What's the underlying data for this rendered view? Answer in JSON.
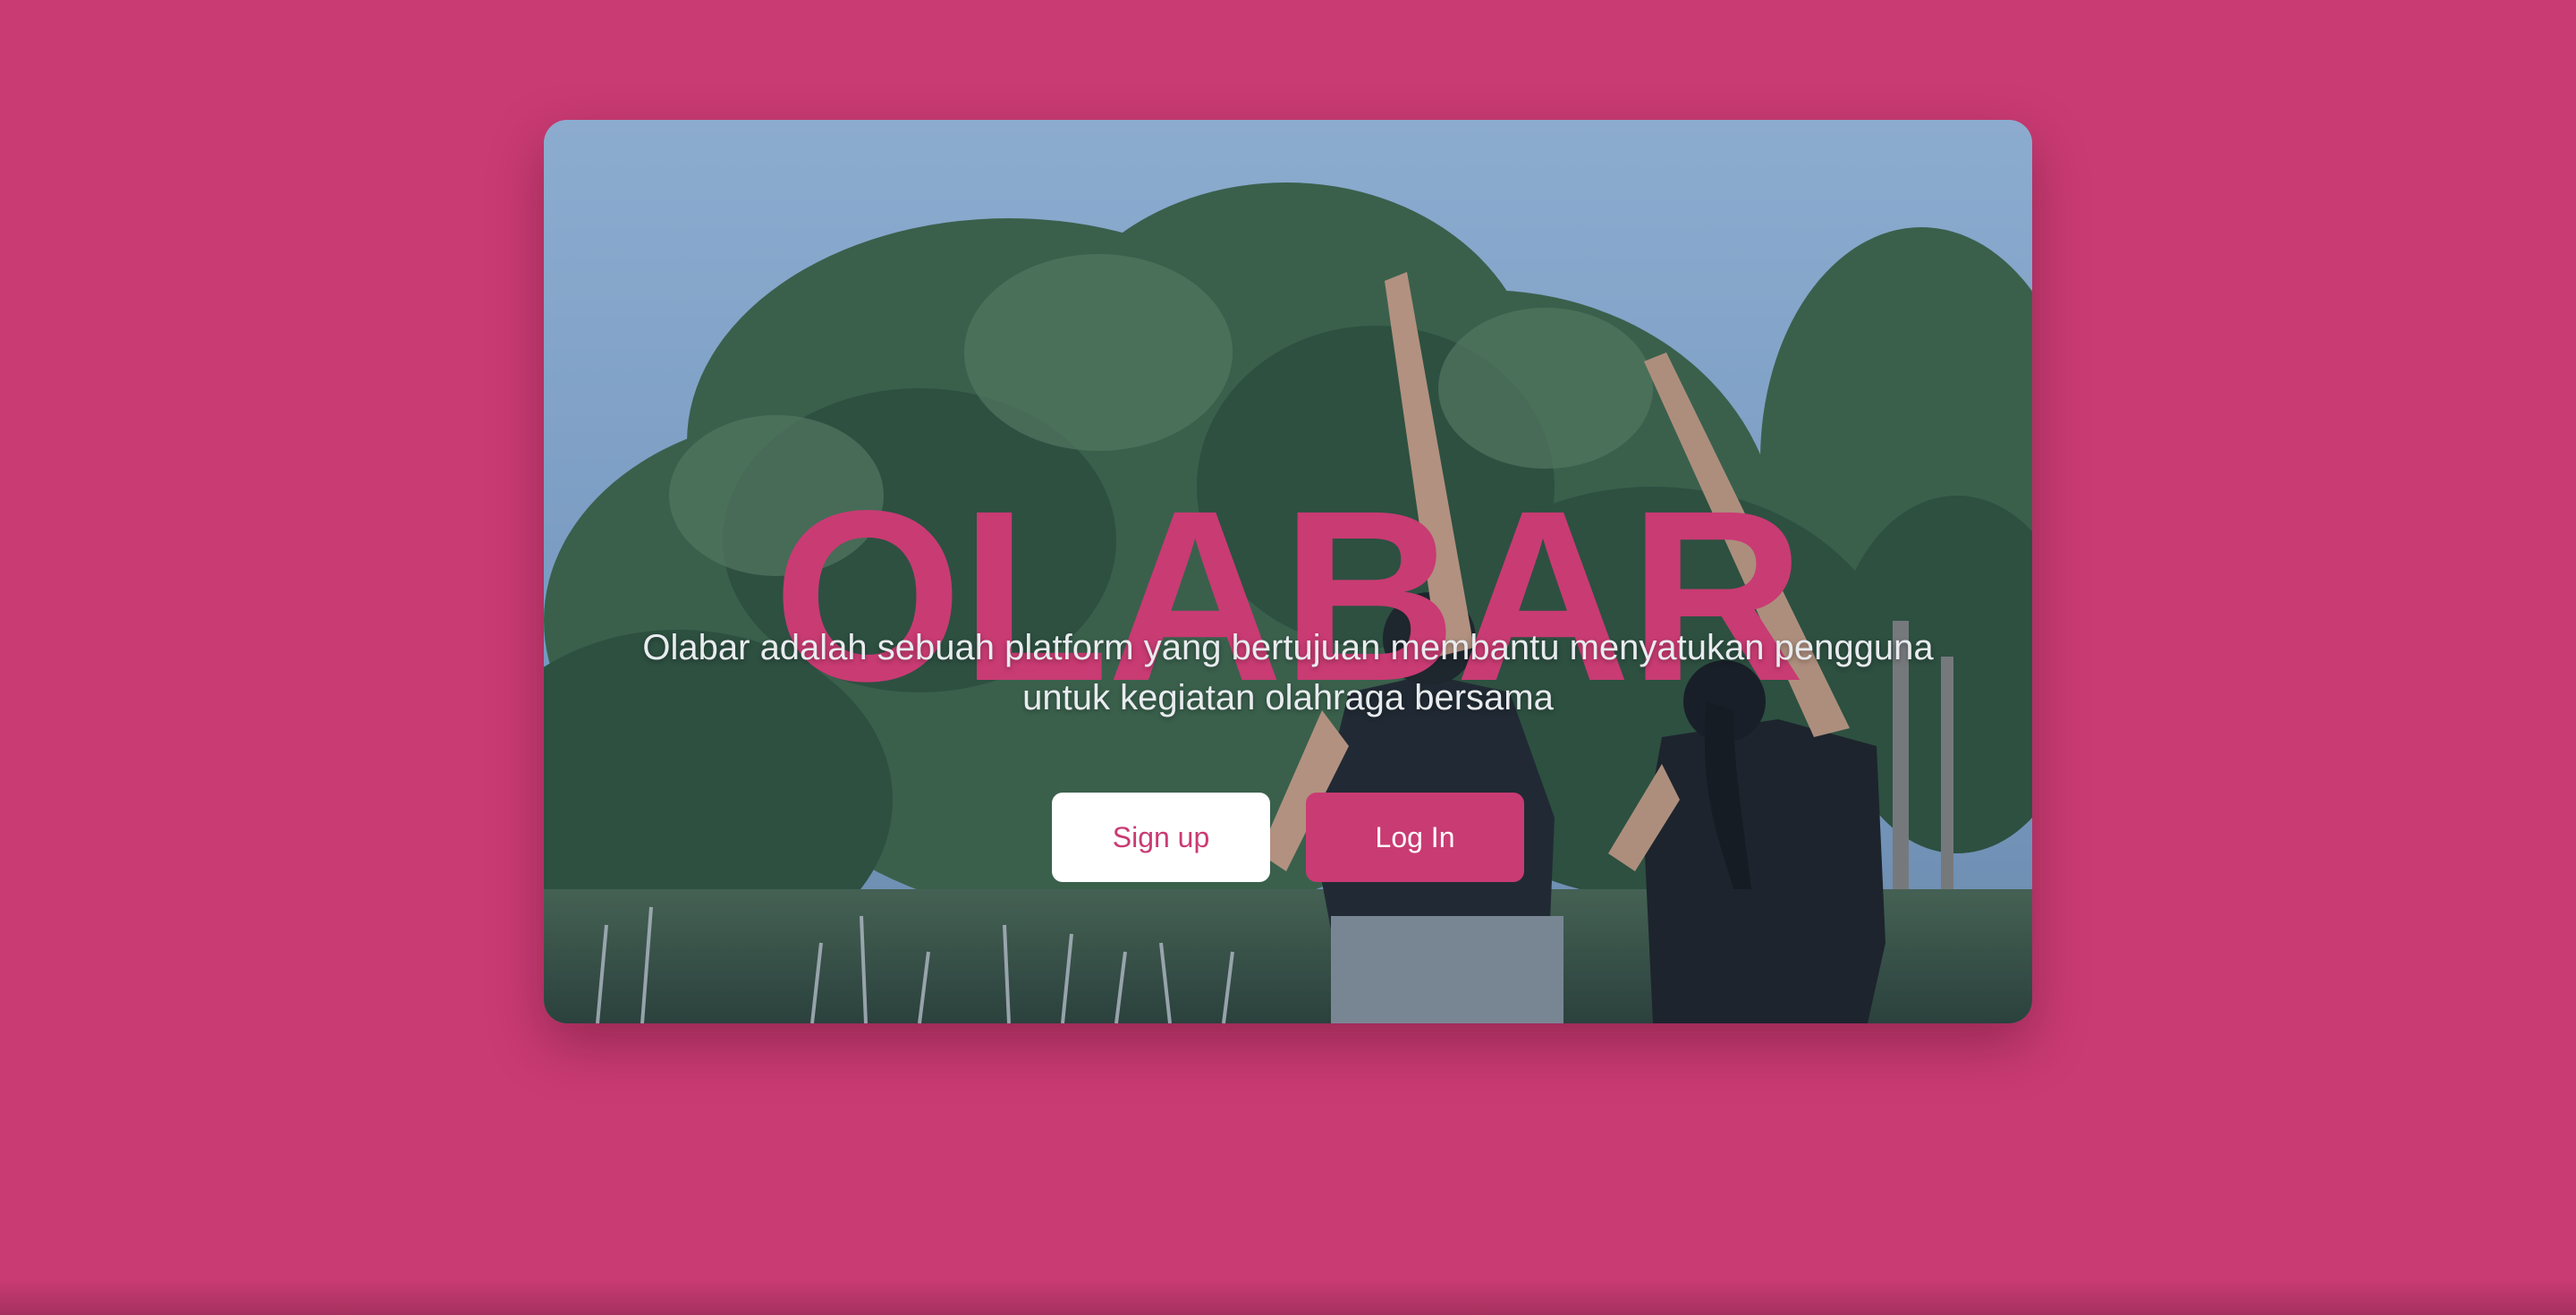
{
  "hero": {
    "title": "OLABAR",
    "tagline": "Olabar adalah sebuah platform yang bertujuan membantu menyatukan pengguna untuk kegiatan olahraga bersama",
    "signup_label": "Sign up",
    "login_label": "Log In",
    "background_image": "two people stretching arms in a grassy park with trees"
  },
  "colors": {
    "brand": "#c93b73",
    "button_light": "#ffffff",
    "tagline_text": "#e9ecef"
  }
}
